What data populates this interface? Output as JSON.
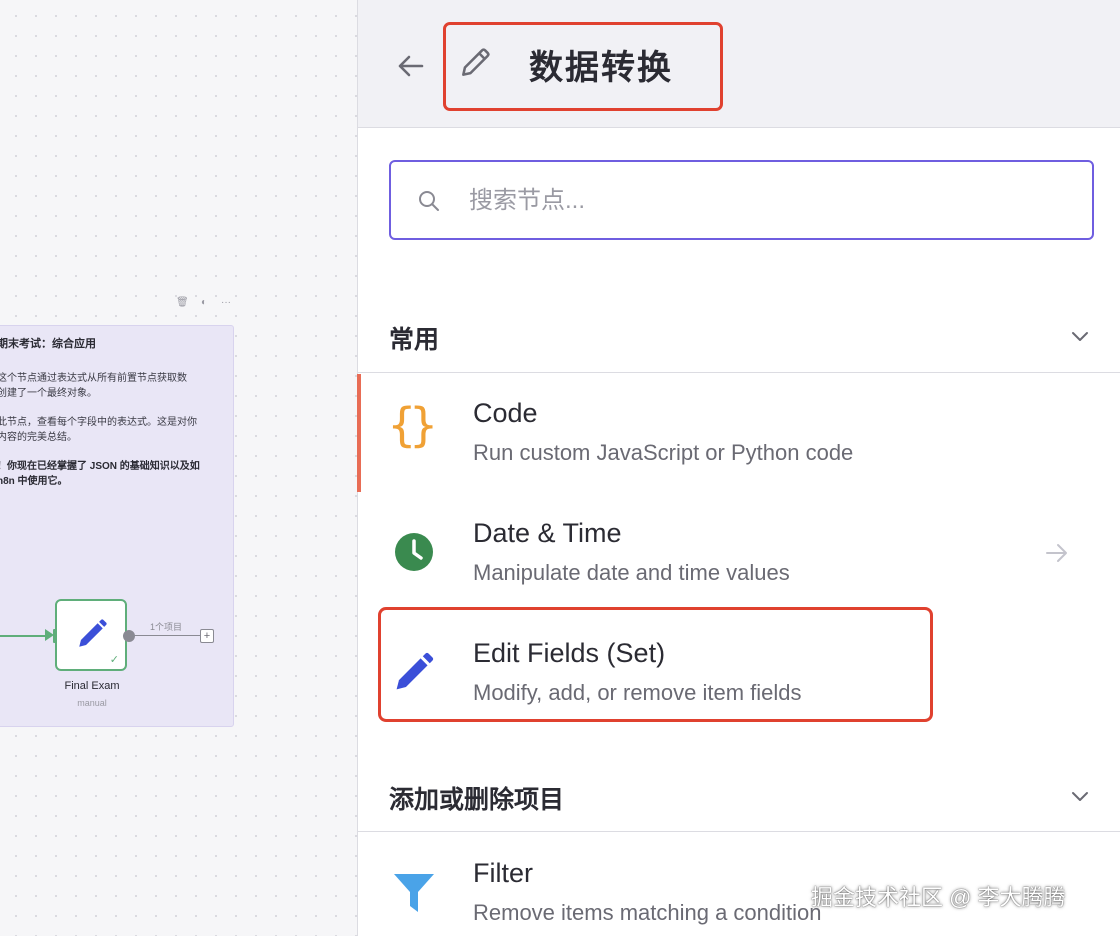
{
  "canvas": {
    "note_tools": [
      "🗑",
      "◐",
      "···"
    ],
    "sticky": {
      "title": "期末考试：综合应用",
      "p1": "这个节点通过表达式从所有前置节点获取数\n创建了一个最终对象。",
      "p2": "此节点，查看每个字段中的表达式。这是对你\n内容的完美总结。",
      "p3": "！你现在已经掌握了 JSON 的基础知识以及如\nn8n 中使用它。"
    },
    "node": {
      "name": "Final Exam",
      "subtitle": "manual",
      "check": "✓",
      "item_count": "1个项目",
      "add": "+"
    }
  },
  "panel": {
    "header": {
      "title": "数据转换"
    },
    "search": {
      "placeholder": "搜索节点..."
    },
    "sections": [
      {
        "title": "常用"
      },
      {
        "title": "添加或删除项目"
      }
    ],
    "items": [
      {
        "name": "Code",
        "description": "Run custom JavaScript or Python code",
        "icon": "code-braces-icon",
        "icon_text": "{}"
      },
      {
        "name": "Date & Time",
        "description": "Manipulate date and time values",
        "icon": "clock-icon"
      },
      {
        "name": "Edit Fields (Set)",
        "description": "Modify, add, or remove item fields",
        "icon": "pencil-icon"
      },
      {
        "name": "Filter",
        "description": "Remove items matching a condition",
        "icon": "filter-icon"
      }
    ]
  },
  "watermark": "掘金技术社区 @ 李大腾腾",
  "colors": {
    "accent_purple": "#6f5ee0",
    "highlight_red": "#e0412f",
    "code_orange": "#f0a135",
    "clock_green": "#3a8a4f",
    "edit_blue": "#3b4fd8",
    "filter_blue": "#4aa3e8",
    "node_green": "#5fae7a"
  }
}
